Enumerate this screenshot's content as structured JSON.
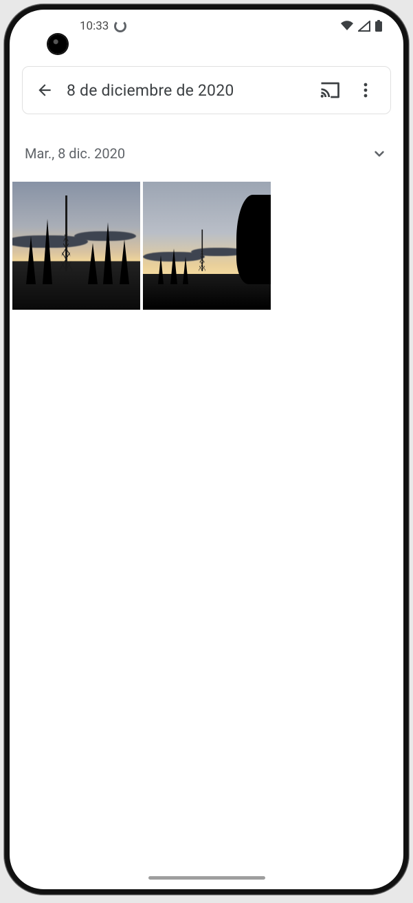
{
  "status": {
    "time": "10:33"
  },
  "appbar": {
    "title": "8 de diciembre de 2020"
  },
  "section": {
    "date_label": "Mar., 8 dic. 2020"
  }
}
